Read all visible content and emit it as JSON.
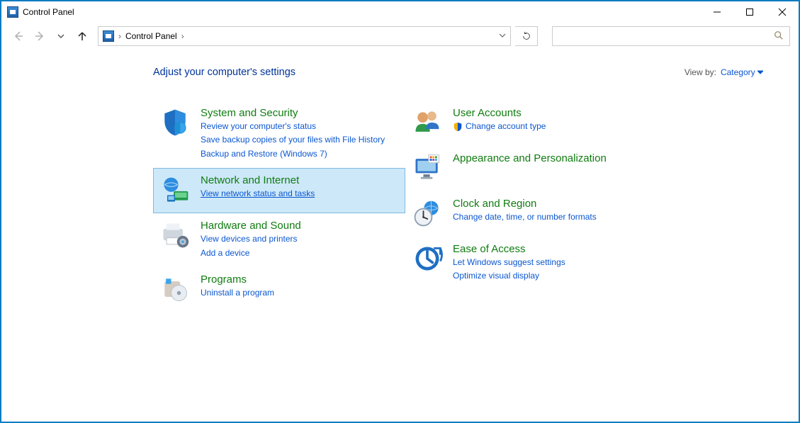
{
  "window": {
    "title": "Control Panel"
  },
  "address": {
    "location": "Control Panel"
  },
  "search": {
    "placeholder": ""
  },
  "header": {
    "subtitle": "Adjust your computer's settings",
    "viewby_label": "View by:",
    "viewby_value": "Category"
  },
  "cats": {
    "system": {
      "title": "System and Security",
      "l1": "Review your computer's status",
      "l2": "Save backup copies of your files with File History",
      "l3": "Backup and Restore (Windows 7)"
    },
    "network": {
      "title": "Network and Internet",
      "l1": "View network status and tasks"
    },
    "hardware": {
      "title": "Hardware and Sound",
      "l1": "View devices and printers",
      "l2": "Add a device"
    },
    "programs": {
      "title": "Programs",
      "l1": "Uninstall a program"
    },
    "users": {
      "title": "User Accounts",
      "l1": "Change account type"
    },
    "appearance": {
      "title": "Appearance and Personalization"
    },
    "clock": {
      "title": "Clock and Region",
      "l1": "Change date, time, or number formats"
    },
    "ease": {
      "title": "Ease of Access",
      "l1": "Let Windows suggest settings",
      "l2": "Optimize visual display"
    }
  }
}
